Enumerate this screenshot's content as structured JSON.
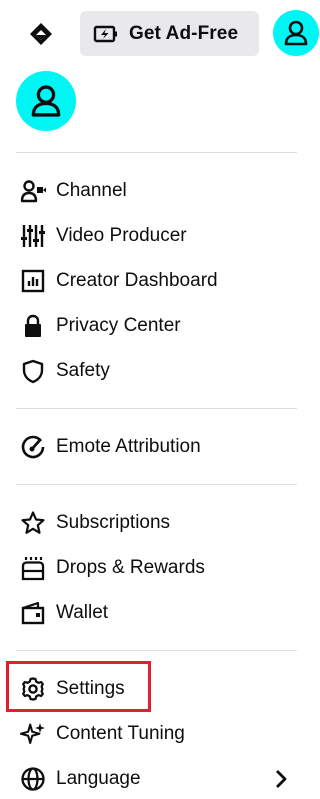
{
  "topbar": {
    "logo_icon": "prime-crown-icon",
    "ad_free_label": "Get Ad-Free",
    "ad_free_icon": "battery-bolt-icon",
    "avatar_icon": "user-icon",
    "avatar_color": "#00f5f5"
  },
  "menu": {
    "group1": [
      {
        "label": "Channel",
        "icon": "channel-icon"
      },
      {
        "label": "Video Producer",
        "icon": "sliders-icon"
      },
      {
        "label": "Creator Dashboard",
        "icon": "dashboard-icon"
      },
      {
        "label": "Privacy Center",
        "icon": "lock-icon"
      },
      {
        "label": "Safety",
        "icon": "shield-icon"
      }
    ],
    "group2": [
      {
        "label": "Emote Attribution",
        "icon": "gauge-icon"
      }
    ],
    "group3": [
      {
        "label": "Subscriptions",
        "icon": "star-icon"
      },
      {
        "label": "Drops & Rewards",
        "icon": "gift-icon"
      },
      {
        "label": "Wallet",
        "icon": "wallet-icon"
      }
    ],
    "group4": [
      {
        "label": "Settings",
        "icon": "gear-icon"
      },
      {
        "label": "Content Tuning",
        "icon": "sparkle-icon"
      },
      {
        "label": "Language",
        "icon": "globe-icon"
      }
    ]
  },
  "highlight_color": "#e0202a"
}
